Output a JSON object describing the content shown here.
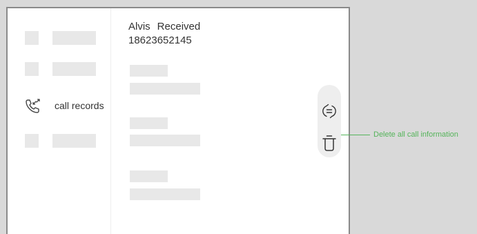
{
  "sidebar": {
    "nav_item_label": "call records",
    "nav_item_icon": "phone-call-records-icon"
  },
  "record": {
    "caller_name": "Alvis",
    "call_status": "Received",
    "phone_number": "18623652145"
  },
  "actions": {
    "top_icon": "sync-exchange-icon",
    "delete_icon": "trash-icon"
  },
  "annotation": {
    "text": "Delete all call information",
    "color": "#55b45a"
  }
}
